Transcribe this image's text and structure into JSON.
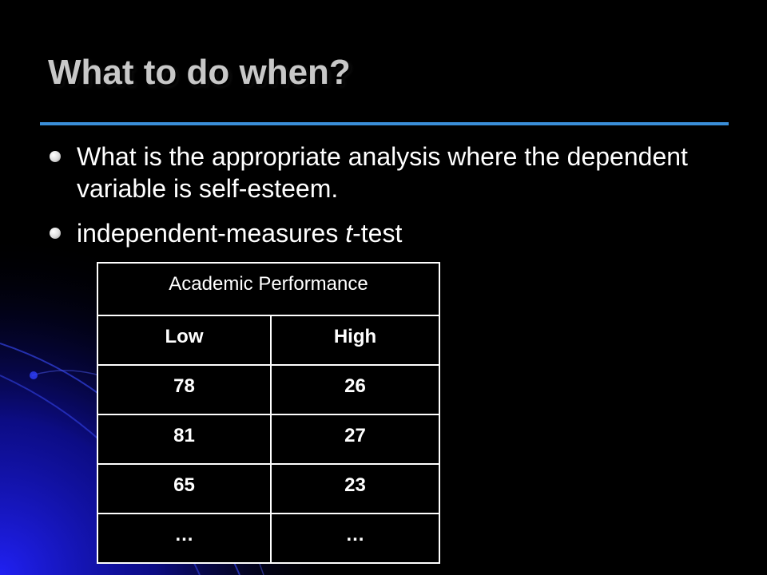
{
  "slide": {
    "title": "What to do when?",
    "bullets": [
      "What is the appropriate analysis where the dependent variable is self-esteem.",
      {
        "prefix": "independent-measures ",
        "italic": "t",
        "suffix": "-test"
      }
    ]
  },
  "table": {
    "header": "Academic Performance",
    "columns": [
      "Low",
      "High"
    ],
    "rows": [
      [
        "78",
        "26"
      ],
      [
        "81",
        "27"
      ],
      [
        "65",
        "23"
      ],
      [
        "…",
        "…"
      ]
    ]
  },
  "colors": {
    "background": "#000000",
    "title_text": "#c8c8c8",
    "accent_rule": "#3a8ed8",
    "background_glow": "#1a1ae0",
    "text": "#ffffff"
  }
}
